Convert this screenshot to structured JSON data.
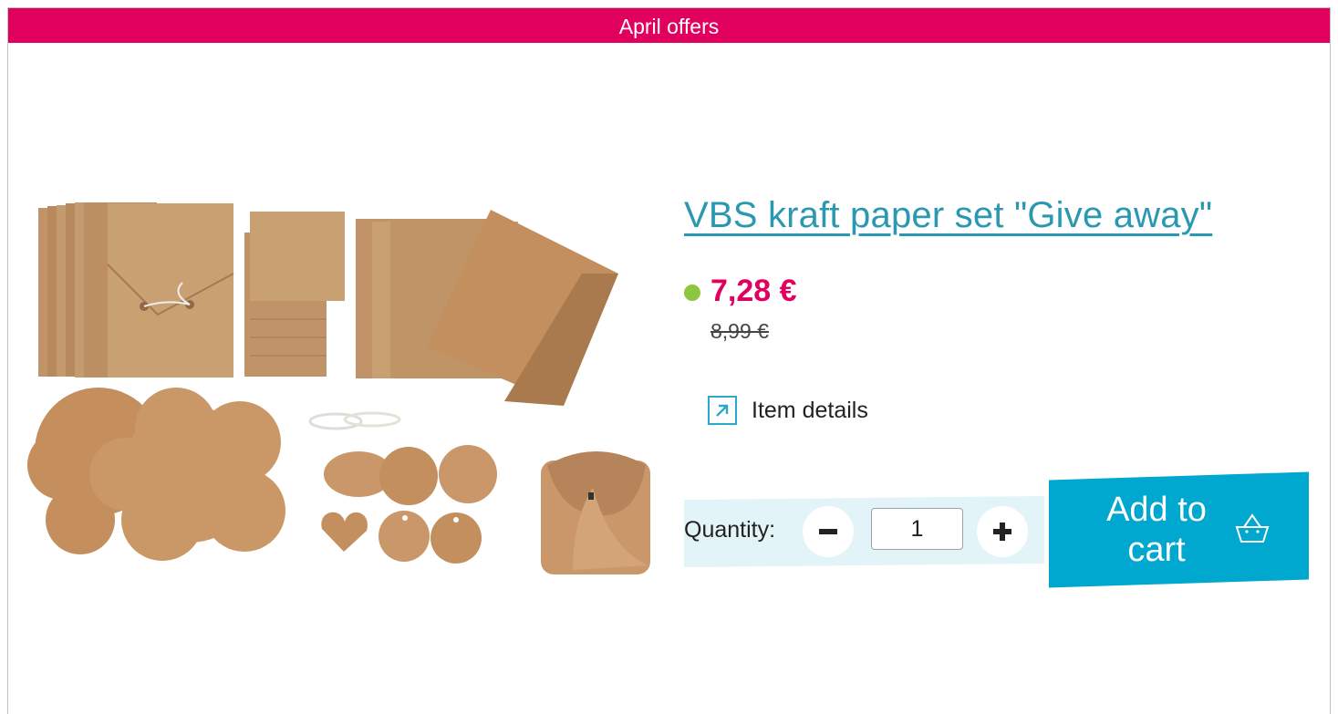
{
  "banner": {
    "text": "April offers"
  },
  "product": {
    "title": "VBS kraft paper set \"Give away\"",
    "price": "7,28 €",
    "old_price": "8,99 €",
    "availability_color": "#8dc63f",
    "image_icon": "product-photo"
  },
  "details_link": {
    "label": "Item details",
    "icon": "external-link-icon"
  },
  "quantity": {
    "label": "Quantity:",
    "value": "1",
    "minus_icon": "minus-icon",
    "plus_icon": "plus-icon"
  },
  "cart": {
    "label": "Add to cart",
    "icon": "basket-icon"
  },
  "colors": {
    "brand": "#e2005f",
    "accent": "#00a7cf",
    "link": "#2a98b0",
    "quantity_bg": "#e3f4f9"
  }
}
